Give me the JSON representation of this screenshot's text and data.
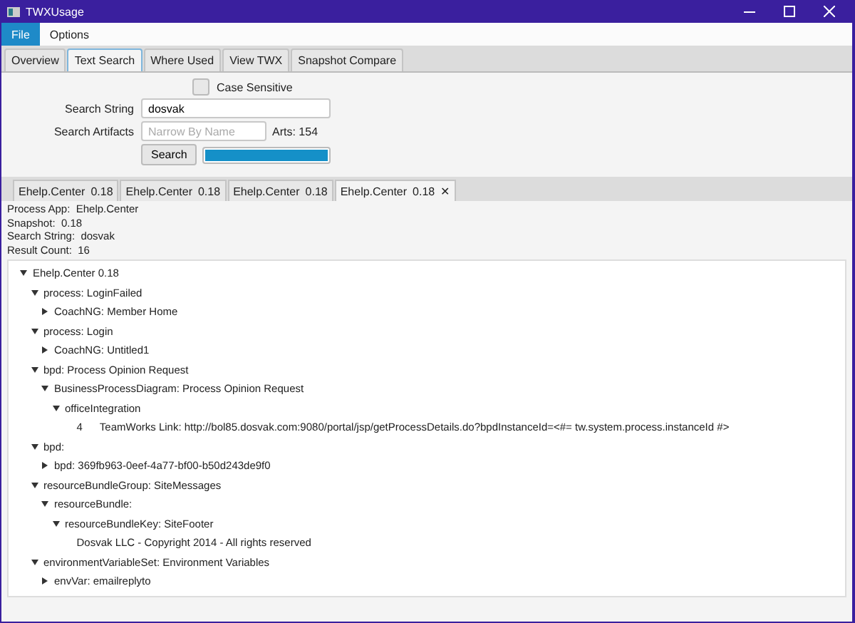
{
  "window": {
    "title": "TWXUsage"
  },
  "menu": [
    {
      "label": "File",
      "selected": true
    },
    {
      "label": "Options",
      "selected": false
    }
  ],
  "tabs": [
    {
      "label": "Overview",
      "selected": false
    },
    {
      "label": "Text Search",
      "selected": true
    },
    {
      "label": "Where Used",
      "selected": false
    },
    {
      "label": "View TWX",
      "selected": false
    },
    {
      "label": "Snapshot Compare",
      "selected": false
    }
  ],
  "form": {
    "case_sensitive": {
      "label": "Case Sensitive",
      "checked": false
    },
    "search_string": {
      "label": "Search String",
      "value": "dosvak"
    },
    "search_artifacts": {
      "label": "Search Artifacts",
      "placeholder": "Narrow By Name",
      "count": "Arts: 154"
    },
    "search_button": "Search",
    "progress": {
      "level": 1
    }
  },
  "result_tabs": [
    {
      "name": "Ehelp.Center",
      "version": "0.18",
      "selected": false
    },
    {
      "name": "Ehelp.Center",
      "version": "0.18",
      "selected": false
    },
    {
      "name": "Ehelp.Center",
      "version": "0.18",
      "selected": false
    },
    {
      "name": "Ehelp.Center",
      "version": "0.18",
      "selected": true,
      "close": "✕"
    }
  ],
  "info": [
    "Process App:  Ehelp.Center",
    "Snapshot:  0.18",
    "Search String:  dosvak",
    "Result Count:  16"
  ],
  "tree": [
    {
      "kind": "node",
      "label": "Ehelp.Center    0.18",
      "expanded": true,
      "children": [
        {
          "kind": "node",
          "label": "process: LoginFailed",
          "expanded": true,
          "children": [
            {
              "kind": "node",
              "label": "CoachNG: Member Home",
              "expanded": false
            }
          ]
        },
        {
          "kind": "node",
          "label": "process: Login",
          "expanded": true,
          "children": [
            {
              "kind": "node",
              "label": "CoachNG: Untitled1",
              "expanded": false
            }
          ]
        },
        {
          "kind": "node",
          "label": "bpd: Process Opinion Request",
          "expanded": true,
          "children": [
            {
              "kind": "node",
              "label": "BusinessProcessDiagram: Process Opinion Request",
              "expanded": true,
              "children": [
                {
                  "kind": "node",
                  "label": "officeIntegration",
                  "expanded": true,
                  "children": [
                    {
                      "kind": "leaf",
                      "number": "4",
                      "label": "TeamWorks Link:  http://bol85.dosvak.com:9080/portal/jsp/getProcessDetails.do?bpdInstanceId=<#= tw.system.process.instanceId #>"
                    }
                  ]
                }
              ]
            }
          ]
        },
        {
          "kind": "node",
          "label": "bpd:",
          "expanded": true,
          "children": [
            {
              "kind": "node",
              "label": "bpd: 369fb963-0eef-4a77-bf00-b50d243de9f0",
              "expanded": false
            }
          ]
        },
        {
          "kind": "node",
          "label": "resourceBundleGroup: SiteMessages",
          "expanded": true,
          "children": [
            {
              "kind": "node",
              "label": "resourceBundle:",
              "expanded": true,
              "children": [
                {
                  "kind": "node",
                  "label": "resourceBundleKey: SiteFooter",
                  "expanded": true,
                  "children": [
                    {
                      "kind": "leaf",
                      "label": "Dosvak LLC - Copyright 2014 - All rights reserved"
                    }
                  ]
                }
              ]
            }
          ]
        },
        {
          "kind": "node",
          "label": "environmentVariableSet: Environment Variables",
          "expanded": true,
          "children": [
            {
              "kind": "node",
              "label": "envVar: emailreplyto",
              "expanded": false
            }
          ]
        }
      ]
    }
  ]
}
